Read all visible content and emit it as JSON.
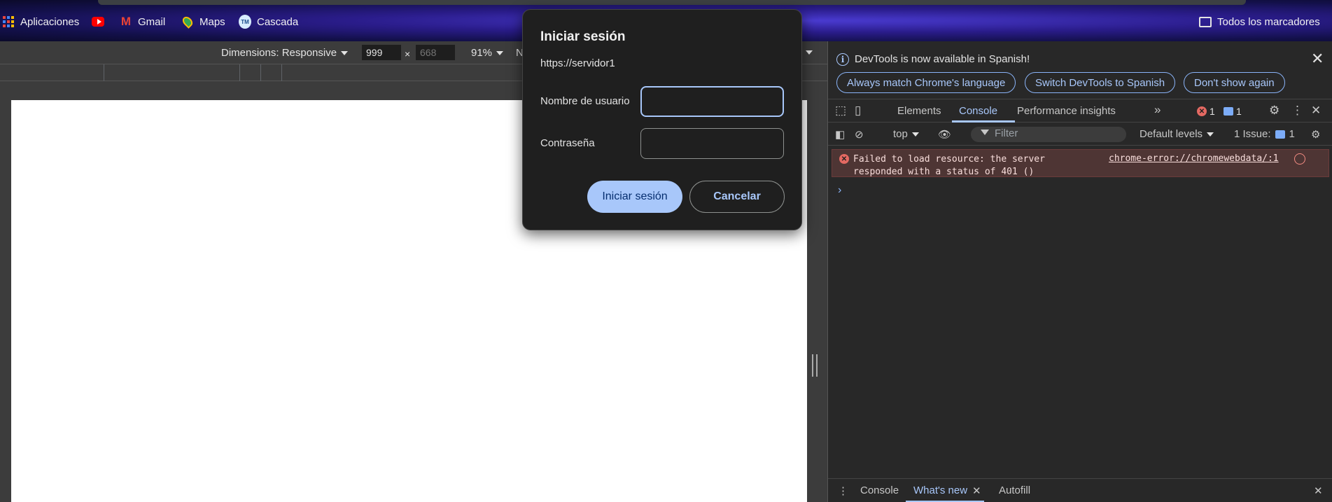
{
  "bookmarks": {
    "apps_label": "Aplicaciones",
    "gmail_label": "Gmail",
    "maps_label": "Maps",
    "cascada_label": "Cascada",
    "tm_icon_text": "TM",
    "all_bookmarks_label": "Todos los marcadores"
  },
  "device_toolbar": {
    "dimensions_label": "Dimensions: Responsive",
    "width_value": "999",
    "height_placeholder": "668",
    "times_sign": "×",
    "zoom_label": "91%",
    "throttle_label": "N"
  },
  "dialog": {
    "title": "Iniciar sesión",
    "origin": "https://servidor1",
    "username_label": "Nombre de usuario",
    "password_label": "Contraseña",
    "submit_label": "Iniciar sesión",
    "cancel_label": "Cancelar"
  },
  "devtools": {
    "infobar": {
      "text": "DevTools is now available in Spanish!",
      "btn_always_match": "Always match Chrome's language",
      "btn_switch": "Switch DevTools to Spanish",
      "btn_dont_show": "Don't show again"
    },
    "tabs": {
      "elements": "Elements",
      "console": "Console",
      "performance": "Performance insights",
      "error_count": "1",
      "message_count": "1"
    },
    "console_toolbar": {
      "context": "top",
      "filter_placeholder": "Filter",
      "levels": "Default levels",
      "issues_label": "1 Issue:",
      "issues_count": "1"
    },
    "error_message": {
      "text": "Failed to load resource: the server\nresponded with a status of 401 ()",
      "source_link": "chrome-error://chromewebdata/:1"
    },
    "drawer": {
      "console_tab": "Console",
      "whats_new_tab": "What's new",
      "autofill_tab": "Autofill"
    }
  }
}
